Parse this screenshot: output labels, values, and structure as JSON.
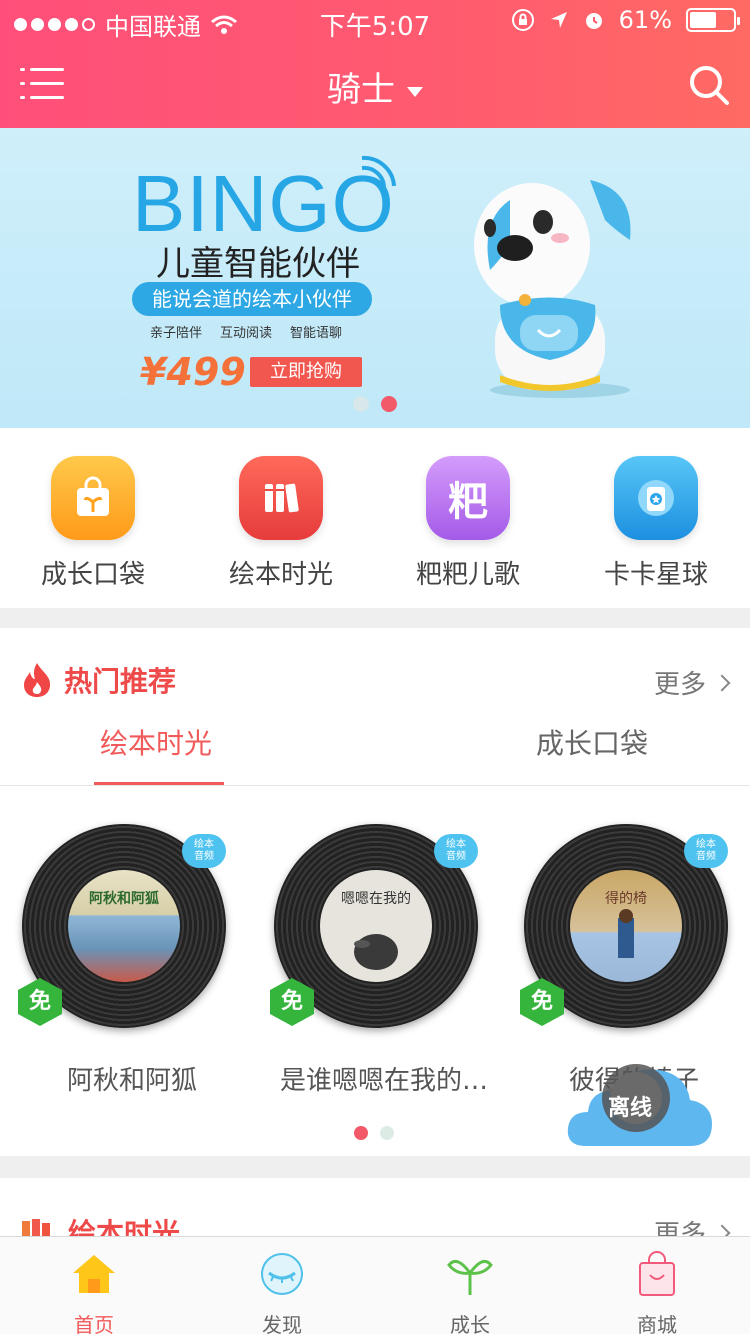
{
  "status_bar": {
    "carrier": "中国联通",
    "time": "下午5:07",
    "battery_percent": "61%",
    "battery_level": 0.61
  },
  "nav": {
    "title": "骑士"
  },
  "banner": {
    "brand": "BINGO",
    "subtitle": "儿童智能伙伴",
    "pill": "能说会道的绘本小伙伴",
    "tags": [
      "亲子陪伴",
      "互动阅读",
      "智能语聊"
    ],
    "price": "¥499",
    "buy_label": "立即抢购"
  },
  "quick_entries": [
    {
      "label": "成长口袋",
      "icon": "shopping-bag-sprout-icon",
      "color": "#ffb02a"
    },
    {
      "label": "绘本时光",
      "icon": "books-icon",
      "color": "#f0524c"
    },
    {
      "label": "粑粑儿歌",
      "icon": "ba-character-icon",
      "color": "#b870f0"
    },
    {
      "label": "卡卡星球",
      "icon": "card-star-icon",
      "color": "#2aa4ec"
    }
  ],
  "hot": {
    "title": "热门推荐",
    "more": "更多",
    "tabs": [
      {
        "label": "绘本时光",
        "active": true
      },
      {
        "label": "成长口袋",
        "active": false
      }
    ],
    "records": [
      {
        "title": "阿秋和阿狐",
        "bubble": "绘本\n音频",
        "free": "免",
        "cover_text": "阿秋和阿狐"
      },
      {
        "title": "是谁嗯嗯在我的…",
        "bubble": "绘本\n音频",
        "free": "免",
        "cover_text": "嗯嗯在我的"
      },
      {
        "title": "彼得的椅子",
        "bubble": "绘本\n音频",
        "free": "免",
        "cover_text": "得的椅"
      }
    ]
  },
  "offline_label": "离线",
  "second_section": {
    "title": "绘本时光",
    "more": "更多"
  },
  "tabbar": [
    {
      "label": "首页",
      "icon": "home-icon",
      "active": true
    },
    {
      "label": "发现",
      "icon": "discover-eye-icon",
      "active": false
    },
    {
      "label": "成长",
      "icon": "sprout-icon",
      "active": false
    },
    {
      "label": "商城",
      "icon": "shop-bag-icon",
      "active": false
    }
  ]
}
